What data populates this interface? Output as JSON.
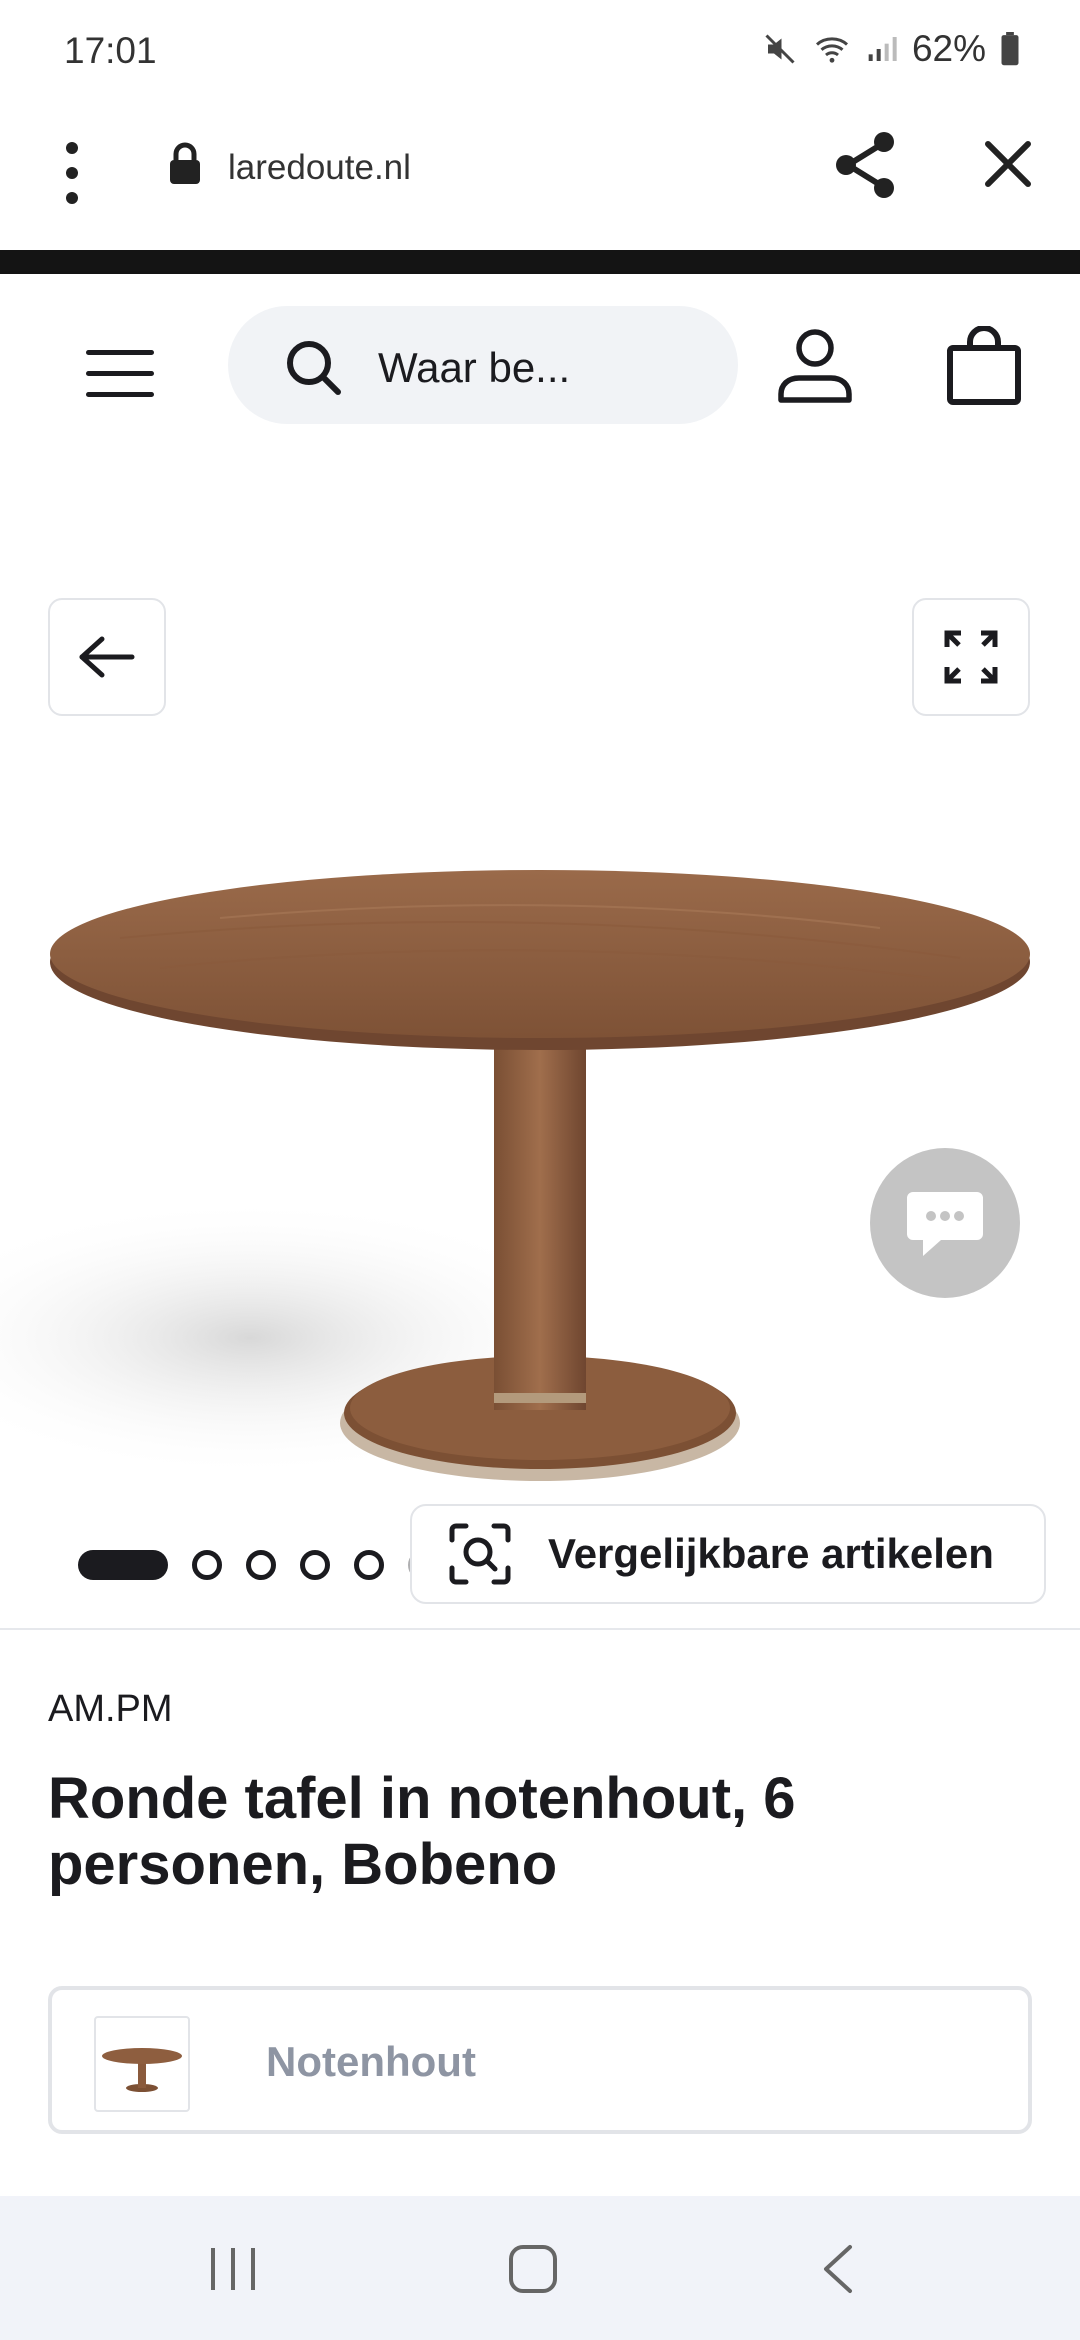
{
  "status_bar": {
    "time": "17:01",
    "battery": "62%"
  },
  "browser": {
    "url": "laredoute.nl"
  },
  "header": {
    "search_placeholder": "Waar be..."
  },
  "gallery": {
    "similar_button_label": "Vergelijkbare artikelen",
    "image_count": 6,
    "active_image_index": 0
  },
  "product": {
    "brand": "AM.PM",
    "title": "Ronde tafel in notenhout, 6 personen, Bobeno",
    "variant_label": "Notenhout"
  },
  "colors": {
    "accent_dark": "#1b1b1f",
    "chat_bubble": "#c4c4c4",
    "variant_text": "#8e95a3",
    "wood": "#8a5a3c"
  },
  "icons": {
    "browser": [
      "more-vert-icon",
      "lock-icon",
      "share-icon",
      "close-icon"
    ],
    "header": [
      "hamburger-icon",
      "search-icon",
      "account-icon",
      "shopping-bag-icon"
    ],
    "gallery": [
      "arrow-left-icon",
      "expand-icon",
      "chat-icon",
      "visual-search-icon"
    ],
    "system_nav": [
      "recent-apps-icon",
      "home-icon",
      "back-icon"
    ]
  }
}
